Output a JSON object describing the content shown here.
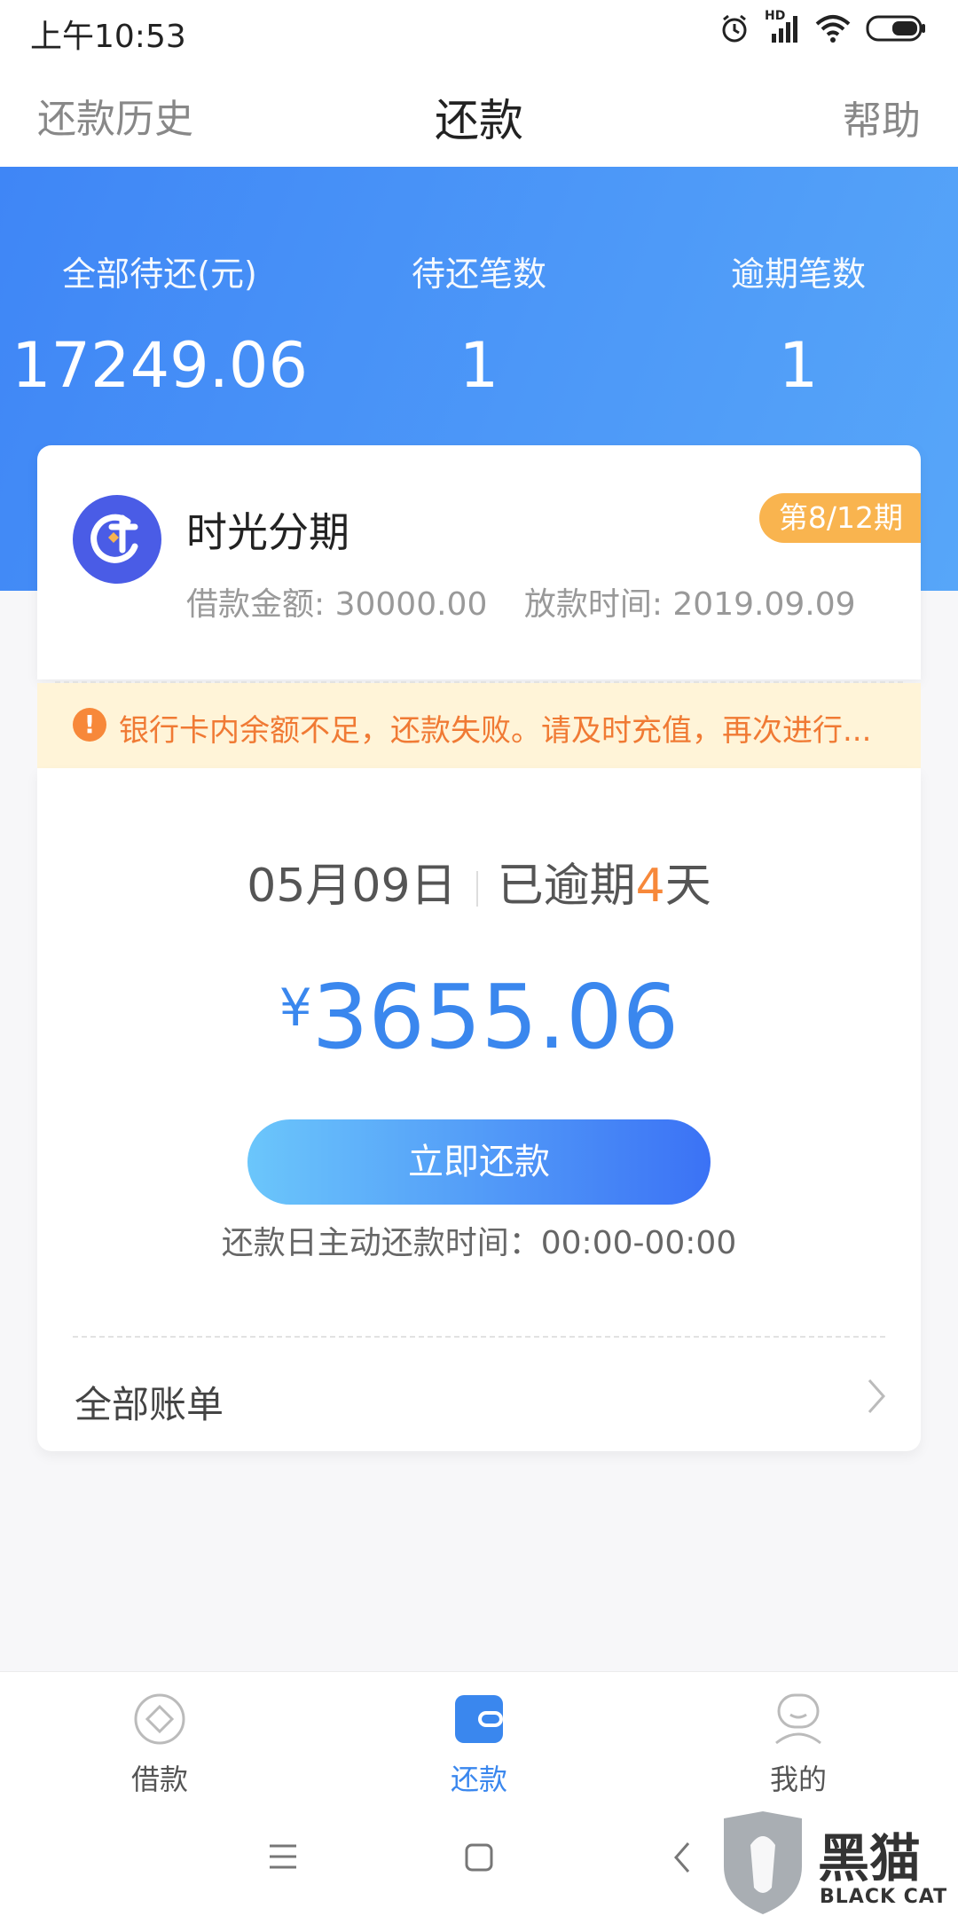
{
  "status_bar": {
    "time": "上午10:53",
    "icons": [
      "alarm-icon",
      "signal-icon",
      "wifi-icon",
      "battery-icon"
    ],
    "hd_label": "HD"
  },
  "header": {
    "left": "还款历史",
    "title": "还款",
    "right": "帮助"
  },
  "summary": {
    "stats": [
      {
        "label": "全部待还(元)",
        "value": "17249.06"
      },
      {
        "label": "待还笔数",
        "value": "1"
      },
      {
        "label": "逾期笔数",
        "value": "1"
      }
    ]
  },
  "loan": {
    "name": "时光分期",
    "period": "第8/12期",
    "amount": "借款金额: 30000.00",
    "date": "放款时间: 2019.09.09"
  },
  "warning": {
    "text": "银行卡内余额不足，还款失败。请及时充值，再次进行..."
  },
  "due": {
    "date": "05月09日",
    "overdue_prefix": "已逾期",
    "overdue_days": "4",
    "overdue_suffix": "天",
    "currency": "¥",
    "amount": "3655.06",
    "pay_button": "立即还款",
    "pay_time": "还款日主动还款时间：00:00-00:00",
    "all_bills": "全部账单"
  },
  "tabs": [
    {
      "label": "借款",
      "icon": "borrow-icon",
      "active": false
    },
    {
      "label": "还款",
      "icon": "repay-icon",
      "active": true
    },
    {
      "label": "我的",
      "icon": "profile-icon",
      "active": false
    }
  ],
  "watermark": {
    "cn": "黑猫",
    "en": "BLACK CAT"
  },
  "colors": {
    "accent": "#3a87ee",
    "banner_start": "#3f86f6",
    "banner_end": "#57a6f9",
    "badge": "#f9b44f",
    "warning_text": "#f07a34",
    "warning_bg": "#fff4d8"
  }
}
